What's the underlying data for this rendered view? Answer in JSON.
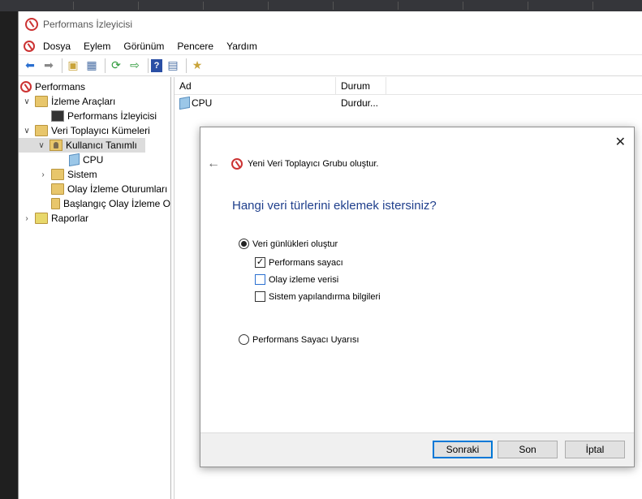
{
  "window": {
    "title": "Performans İzleyicisi"
  },
  "menu": [
    "Dosya",
    "Eylem",
    "Görünüm",
    "Pencere",
    "Yardım"
  ],
  "tree": {
    "root": "Performans",
    "monitoring_tools": "İzleme Araçları",
    "performance_monitor": "Performans İzleyicisi",
    "collector_sets": "Veri Toplayıcı Kümeleri",
    "user_defined": "Kullanıcı Tanımlı",
    "cpu": "CPU",
    "system": "Sistem",
    "event_trace": "Olay İzleme Oturumları",
    "startup_trace": "Başlangıç Olay İzleme O",
    "reports": "Raporlar"
  },
  "list": {
    "columns": [
      "Ad",
      "Durum"
    ],
    "rows": [
      {
        "name": "CPU",
        "status": "Durdur..."
      }
    ]
  },
  "dialog": {
    "title": "Yeni Veri Toplayıcı Grubu oluştur.",
    "question": "Hangi veri türlerini eklemek istersiniz?",
    "option_create_logs": "Veri günlükleri oluştur",
    "check_perf_counter": "Performans sayacı",
    "check_event_trace": "Olay izleme verisi",
    "check_system_config": "Sistem yapılandırma bilgileri",
    "option_perf_alert": "Performans Sayacı Uyarısı",
    "btn_next": "Sonraki",
    "btn_finish": "Son",
    "btn_cancel": "İptal",
    "close": "✕"
  }
}
